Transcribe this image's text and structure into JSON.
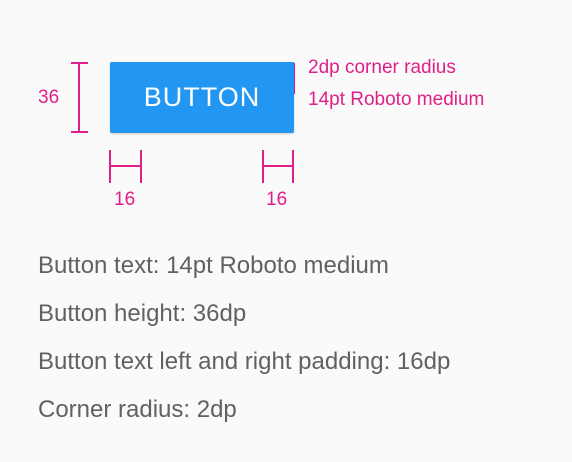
{
  "colors": {
    "background": "#fafafa",
    "button_fill": "#2196f3",
    "button_text": "#ffffff",
    "annotation": "#e0208a",
    "body_text": "#616161"
  },
  "sample_button": {
    "label": "BUTTON"
  },
  "annotations": {
    "height_value": "36",
    "corner_radius": "2dp corner radius",
    "text_style": "14pt Roboto medium",
    "left_padding_value": "16",
    "right_padding_value": "16"
  },
  "notes": [
    "Button text: 14pt Roboto medium",
    "Button height: 36dp",
    "Button text left and right padding: 16dp",
    "Corner radius: 2dp"
  ]
}
